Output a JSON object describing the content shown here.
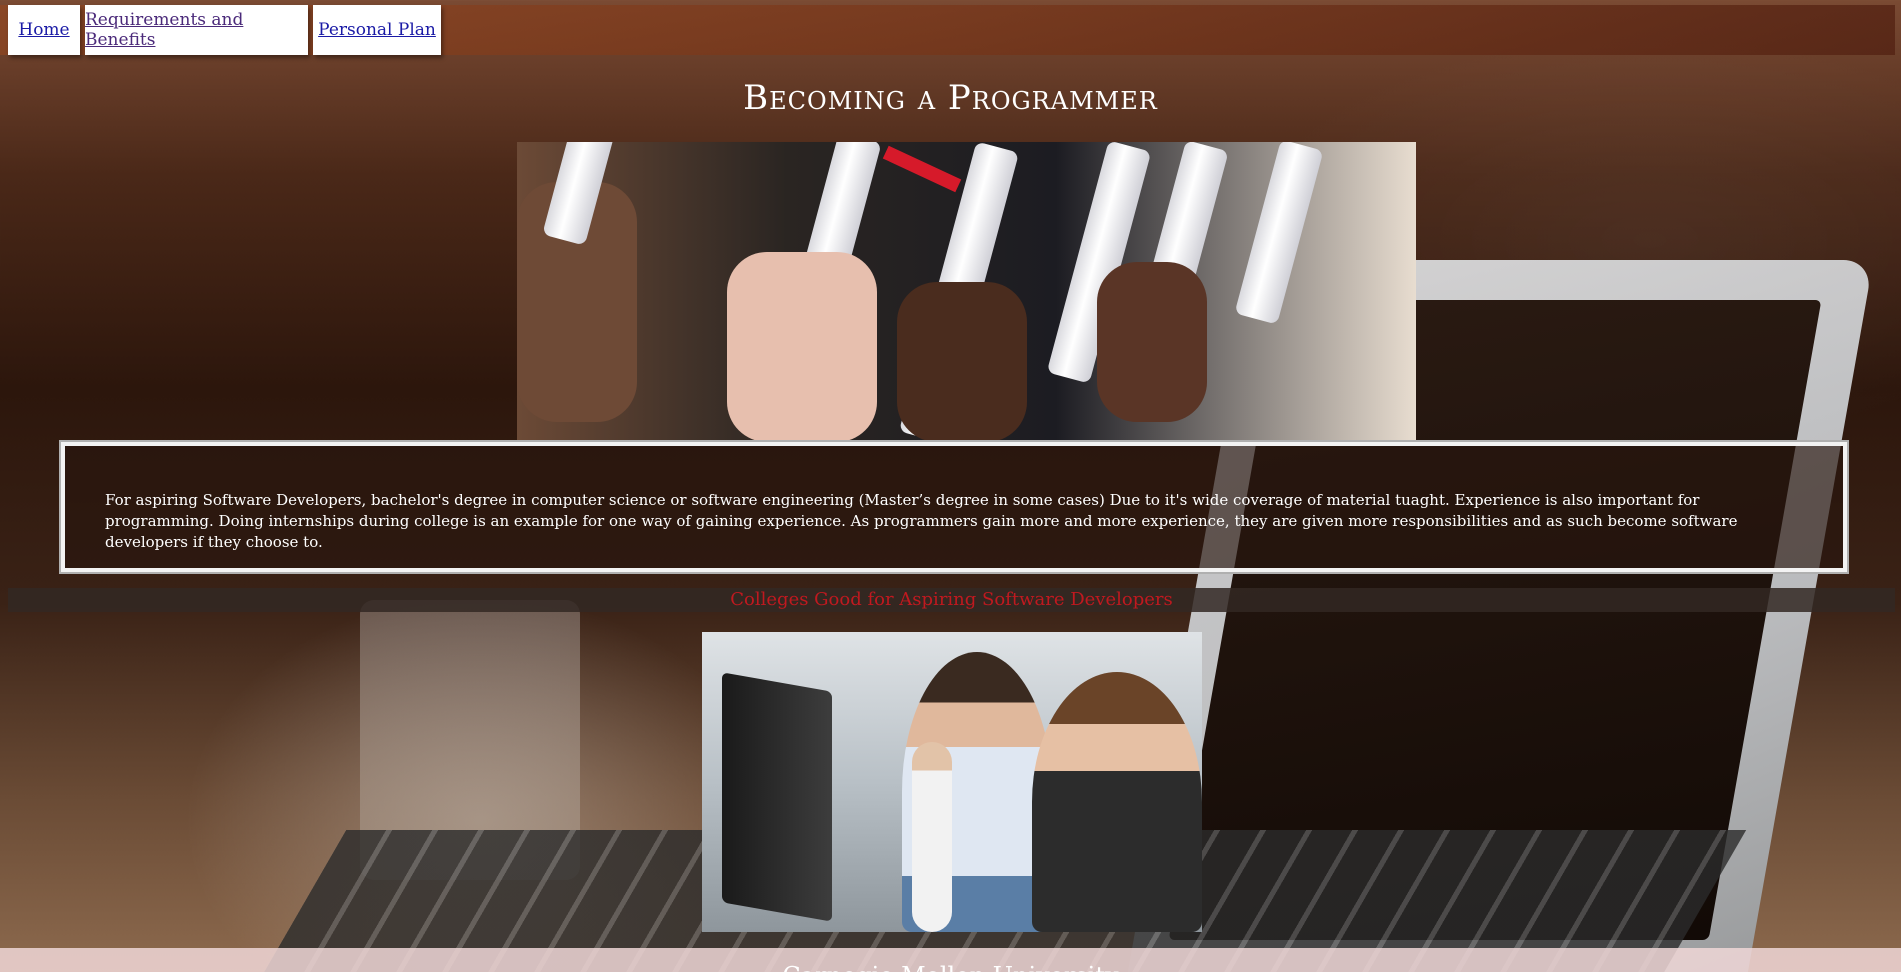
{
  "nav": {
    "tabs": [
      {
        "label": "Home"
      },
      {
        "label": "Requirements and Benefits"
      },
      {
        "label": "Personal Plan"
      }
    ]
  },
  "header": {
    "title": "Becoming a Programmer"
  },
  "hero_image": {
    "description_icon": "graduation-diplomas-image"
  },
  "info": {
    "paragraph": "For aspiring Software Developers, bachelor's degree in computer science or software engineering (Master’s degree in some cases) Due to it's wide coverage of material tuaght. Experience is also important for programming. Doing internships during college is an example for one way of gaining experience. As programmers gain more and more experience, they are given more responsibilities and as such become software developers if they choose to."
  },
  "colleges": {
    "heading": "Colleges Good for Aspiring Software Developers",
    "color": "#c0191f"
  },
  "section_image": {
    "description_icon": "students-at-computer-image"
  },
  "footer_partial": {
    "text": "Carnegie Mellon University"
  }
}
